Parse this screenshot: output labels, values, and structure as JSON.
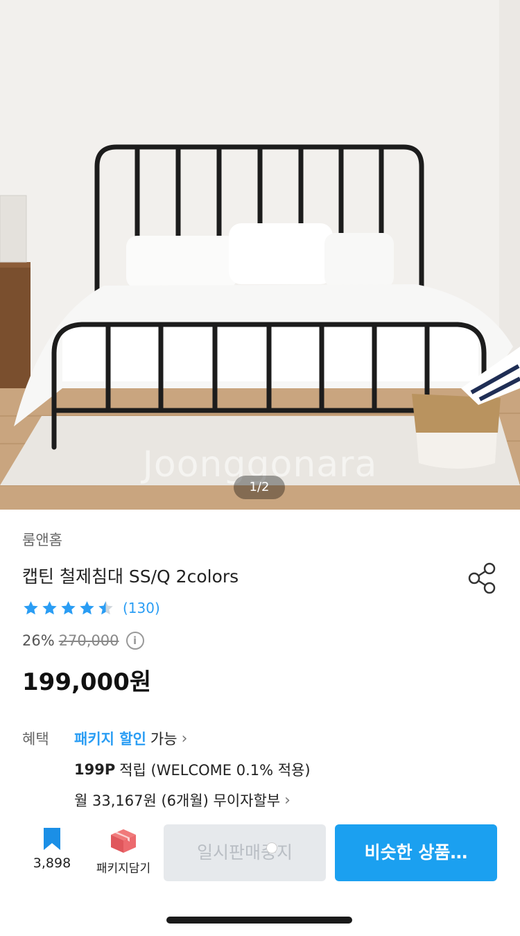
{
  "hero": {
    "watermark": "Joonggonara",
    "pager": "1/2"
  },
  "product": {
    "brand": "룸앤홈",
    "title": "캡틴 철제침대 SS/Q 2colors",
    "rating_value": 4.5,
    "reviews": "(130)",
    "discount": "26%",
    "original_price": "270,000",
    "price": "199,000원"
  },
  "benefits": {
    "label": "혜택",
    "row1_highlight": "패키지 할인",
    "row1_text": "가능",
    "row2_bold": "199P",
    "row2_text": "적립 (WELCOME 0.1% 적용)",
    "row3_text": "월 33,167원 (6개월) 무이자할부"
  },
  "bottom": {
    "bookmark_count": "3,898",
    "package_label": "패키지담기",
    "sold_button": "일시판매중지",
    "similar_button": "비슷한 상품…"
  },
  "colors": {
    "accent": "#1ba0f0",
    "star": "#2a9df4"
  },
  "icons": [
    "share-icon",
    "star-icon",
    "info-icon",
    "chevron-right-icon",
    "bookmark-icon",
    "package-box-icon"
  ]
}
